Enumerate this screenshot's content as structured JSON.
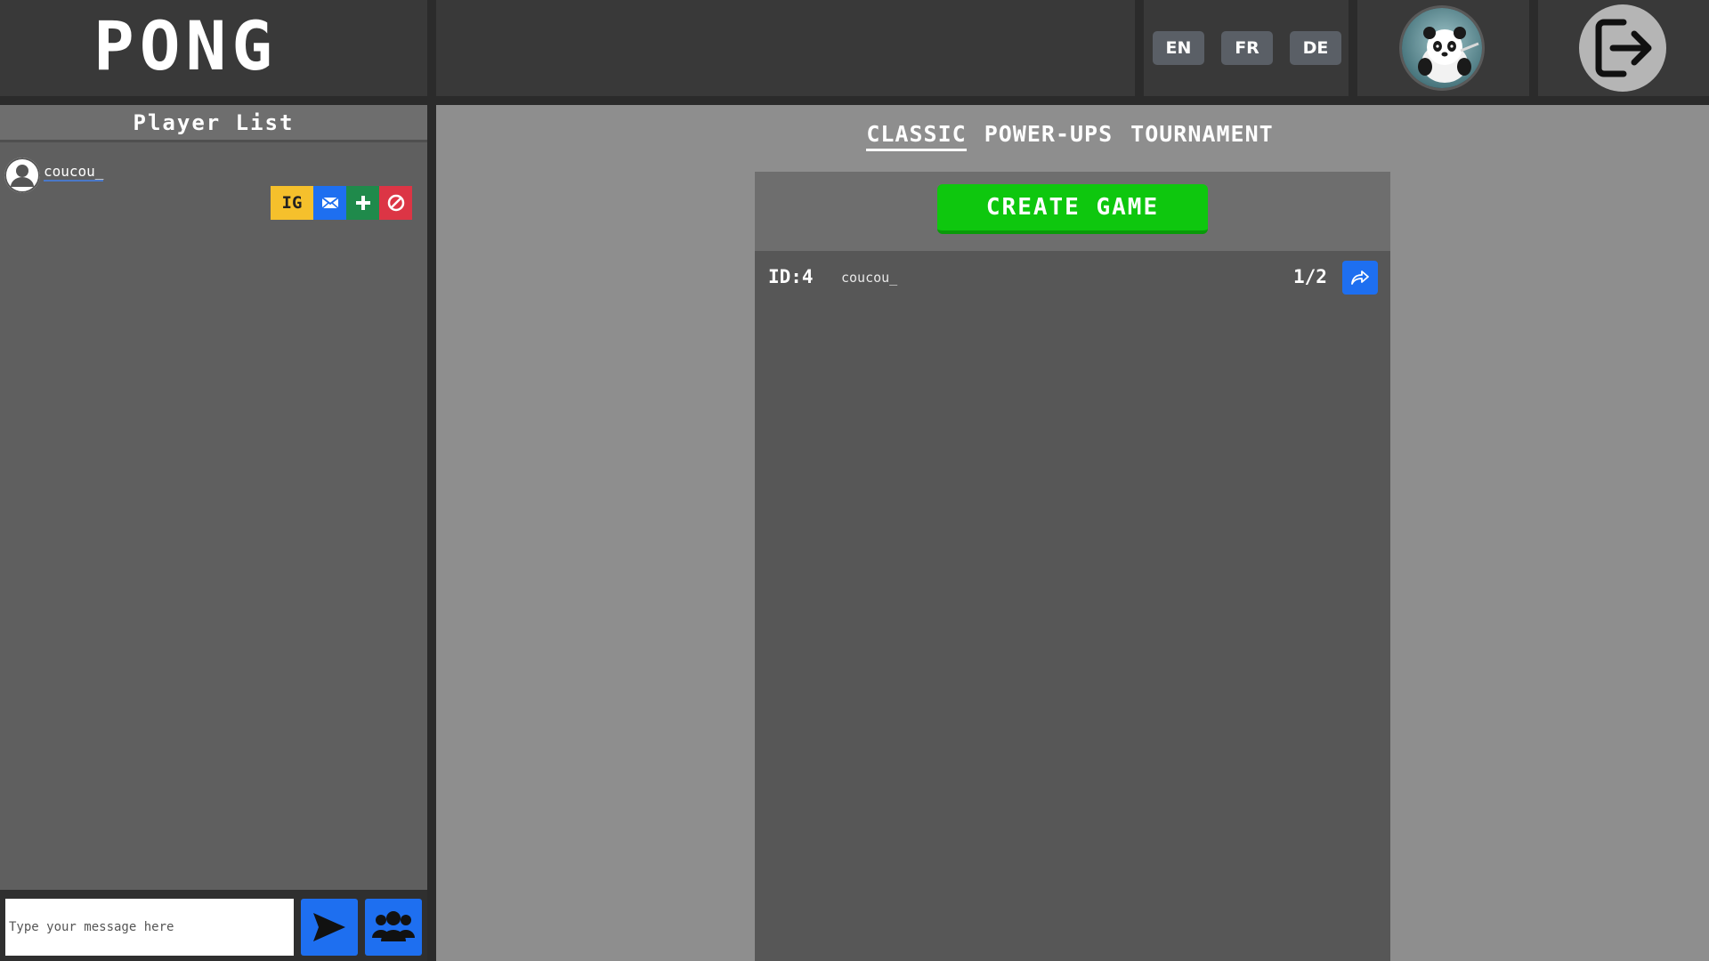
{
  "header": {
    "logo": "PONG",
    "languages": [
      "EN",
      "FR",
      "DE"
    ]
  },
  "sidebar": {
    "title": "Player List",
    "players": [
      {
        "name": "coucou_",
        "actions": {
          "invite_label": "IG",
          "icons": [
            "envelope-icon",
            "plus-icon",
            "block-icon"
          ]
        }
      }
    ]
  },
  "chat": {
    "placeholder": "Type your message here",
    "send_icon": "send-icon",
    "group_icon": "users-icon"
  },
  "modes": {
    "tabs": [
      "CLASSIC",
      "POWER-UPS",
      "TOURNAMENT"
    ],
    "active": "CLASSIC"
  },
  "lobby": {
    "create_label": "CREATE GAME",
    "games": [
      {
        "id_label": "ID:4",
        "owner": "coucou_",
        "players": "1/2"
      }
    ]
  },
  "colors": {
    "accent_blue": "#1e6ff0",
    "create_green": "#0ec70e",
    "invite_yellow": "#f5c02c",
    "add_green": "#1f8a4b",
    "block_red": "#dc3545"
  }
}
